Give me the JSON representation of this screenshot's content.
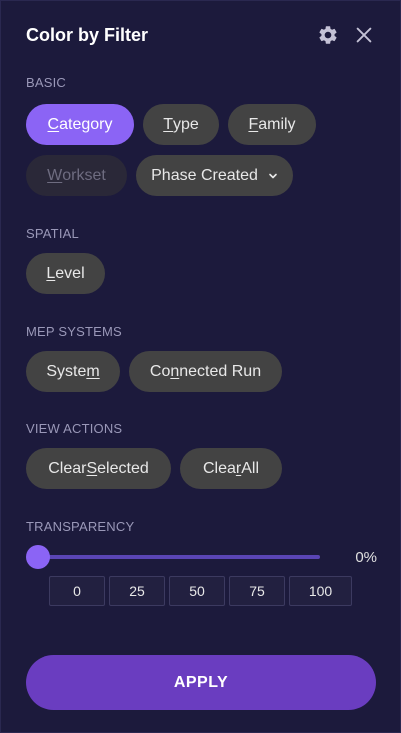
{
  "header": {
    "title": "Color by Filter",
    "settings_icon": "gear-icon",
    "close_icon": "close-icon"
  },
  "sections": {
    "basic": "BASIC",
    "spatial": "SPATIAL",
    "mep": "MEP SYSTEMS",
    "view_actions": "VIEW ACTIONS",
    "transparency": "TRANSPARENCY"
  },
  "basic": {
    "category": {
      "before": "",
      "u": "C",
      "after": "ategory",
      "state": "active"
    },
    "type": {
      "before": "",
      "u": "T",
      "after": "ype"
    },
    "family": {
      "before": "",
      "u": "F",
      "after": "amily"
    },
    "workset": {
      "before": "",
      "u": "W",
      "after": "orkset",
      "state": "disabled"
    },
    "phase": {
      "label": "Phase Created"
    }
  },
  "spatial": {
    "level": {
      "before": "",
      "u": "L",
      "after": "evel"
    }
  },
  "mep": {
    "system": {
      "before": "Syste",
      "u": "m",
      "after": ""
    },
    "connected": {
      "before": "Co",
      "u": "n",
      "after": "nected Run"
    }
  },
  "view_actions": {
    "clear_selected": {
      "before": "Clear ",
      "u": "S",
      "after": "elected"
    },
    "clear_all": {
      "before": "Clea",
      "u": "r",
      "after": " All"
    }
  },
  "transparency": {
    "value": 0,
    "value_label": "0%",
    "presets": [
      "0",
      "25",
      "50",
      "75",
      "100"
    ]
  },
  "apply": {
    "label": "APPLY"
  },
  "colors": {
    "accent": "#8b64f5",
    "apply": "#6a3dc0",
    "background": "#1c1a3c",
    "pill": "#434343"
  }
}
